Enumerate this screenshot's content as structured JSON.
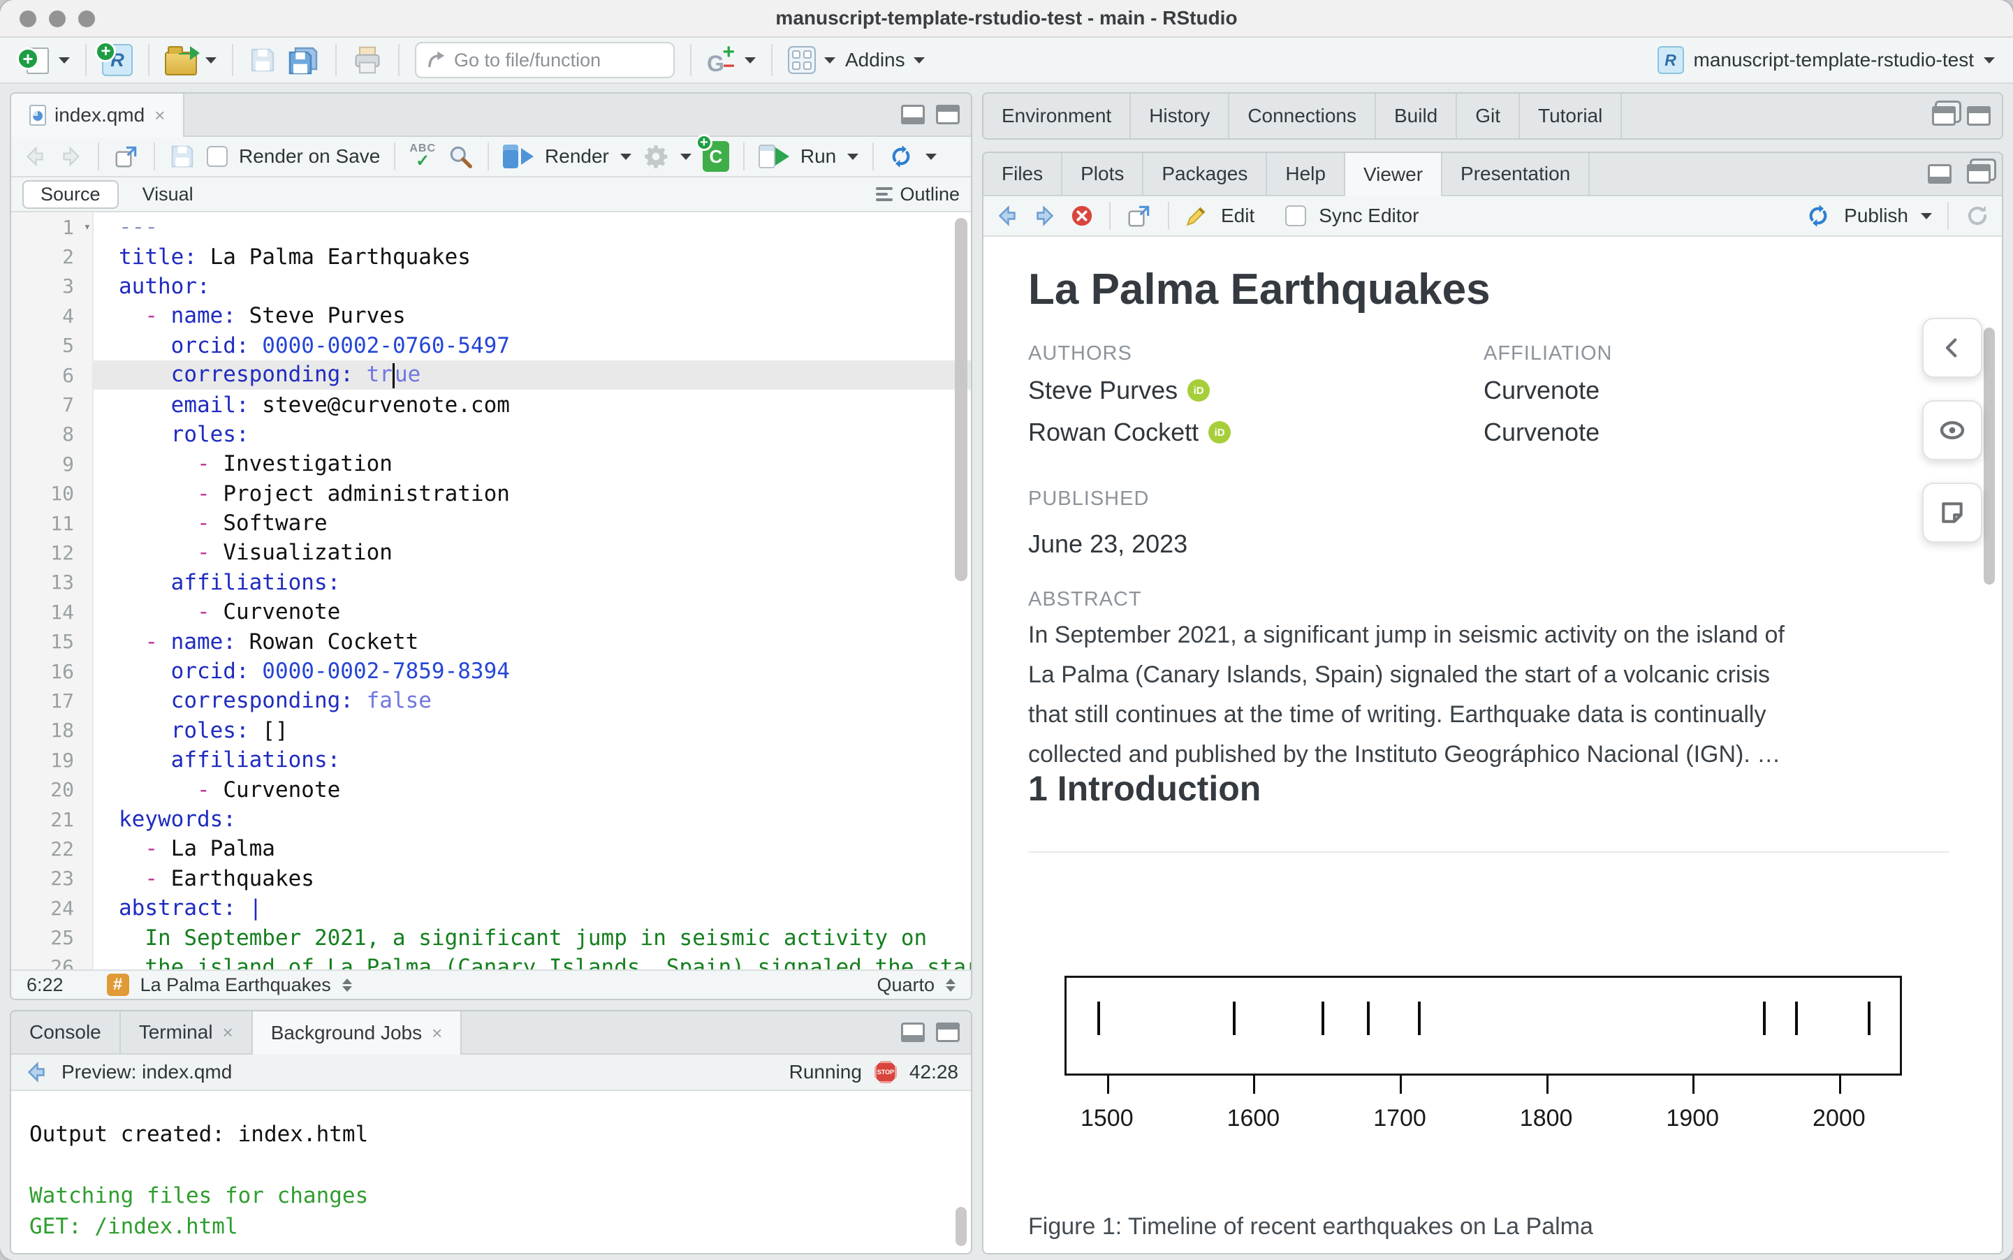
{
  "window": {
    "title": "manuscript-template-rstudio-test - main - RStudio"
  },
  "main_toolbar": {
    "goto_placeholder": "Go to file/function",
    "addins_label": "Addins",
    "project_name": "manuscript-template-rstudio-test"
  },
  "editor": {
    "tabs": [
      {
        "label": "index.qmd",
        "active": true,
        "closable": true
      }
    ],
    "toolbar": {
      "render_on_save": "Render on Save",
      "render": "Render",
      "run": "Run"
    },
    "mode_tabs": {
      "source": "Source",
      "visual": "Visual",
      "outline": "Outline"
    },
    "status": {
      "cursor": "6:22",
      "section": "La Palma Earthquakes",
      "mode": "Quarto"
    },
    "code_lines": [
      [
        [
          "---",
          "delim"
        ]
      ],
      [
        [
          "title:",
          "key"
        ],
        [
          " La Palma Earthquakes",
          "val"
        ]
      ],
      [
        [
          "author:",
          "key"
        ]
      ],
      [
        [
          "  ",
          "val"
        ],
        [
          "- ",
          "dash"
        ],
        [
          "name:",
          "key"
        ],
        [
          " Steve Purves",
          "val"
        ]
      ],
      [
        [
          "    ",
          "val"
        ],
        [
          "orcid:",
          "key"
        ],
        [
          " 0000-0002-0760-5497",
          "num"
        ]
      ],
      [
        [
          "    ",
          "val"
        ],
        [
          "corresponding:",
          "key"
        ],
        [
          " tr",
          "bool"
        ],
        [
          "",
          "caret"
        ],
        [
          "ue",
          "bool"
        ]
      ],
      [
        [
          "    ",
          "val"
        ],
        [
          "email:",
          "key"
        ],
        [
          " steve@curvenote.com",
          "val"
        ]
      ],
      [
        [
          "    ",
          "val"
        ],
        [
          "roles:",
          "key"
        ]
      ],
      [
        [
          "      ",
          "val"
        ],
        [
          "- ",
          "dash"
        ],
        [
          "Investigation",
          "val"
        ]
      ],
      [
        [
          "      ",
          "val"
        ],
        [
          "- ",
          "dash"
        ],
        [
          "Project administration",
          "val"
        ]
      ],
      [
        [
          "      ",
          "val"
        ],
        [
          "- ",
          "dash"
        ],
        [
          "Software",
          "val"
        ]
      ],
      [
        [
          "      ",
          "val"
        ],
        [
          "- ",
          "dash"
        ],
        [
          "Visualization",
          "val"
        ]
      ],
      [
        [
          "    ",
          "val"
        ],
        [
          "affiliations:",
          "key"
        ]
      ],
      [
        [
          "      ",
          "val"
        ],
        [
          "- ",
          "dash"
        ],
        [
          "Curvenote",
          "val"
        ]
      ],
      [
        [
          "  ",
          "val"
        ],
        [
          "- ",
          "dash"
        ],
        [
          "name:",
          "key"
        ],
        [
          " Rowan Cockett",
          "val"
        ]
      ],
      [
        [
          "    ",
          "val"
        ],
        [
          "orcid:",
          "key"
        ],
        [
          " 0000-0002-7859-8394",
          "num"
        ]
      ],
      [
        [
          "    ",
          "val"
        ],
        [
          "corresponding:",
          "key"
        ],
        [
          " false",
          "bool"
        ]
      ],
      [
        [
          "    ",
          "val"
        ],
        [
          "roles:",
          "key"
        ],
        [
          " []",
          "val"
        ]
      ],
      [
        [
          "    ",
          "val"
        ],
        [
          "affiliations:",
          "key"
        ]
      ],
      [
        [
          "      ",
          "val"
        ],
        [
          "- ",
          "dash"
        ],
        [
          "Curvenote",
          "val"
        ]
      ],
      [
        [
          "keywords:",
          "key"
        ]
      ],
      [
        [
          "  ",
          "val"
        ],
        [
          "- ",
          "dash"
        ],
        [
          "La Palma",
          "val"
        ]
      ],
      [
        [
          "  ",
          "val"
        ],
        [
          "- ",
          "dash"
        ],
        [
          "Earthquakes",
          "val"
        ]
      ],
      [
        [
          "abstract:",
          "key"
        ],
        [
          " |",
          "key"
        ]
      ],
      [
        [
          "  In September 2021, a significant jump in seismic activity on",
          "str"
        ]
      ],
      [
        [
          "  the island of La Palma (Canary Islands, Spain) signaled the start",
          "str"
        ]
      ]
    ]
  },
  "console": {
    "tabs": [
      {
        "label": "Console"
      },
      {
        "label": "Terminal",
        "closable": true
      },
      {
        "label": "Background Jobs",
        "closable": true,
        "active": true
      }
    ],
    "toolbar": {
      "preview": "Preview: index.qmd",
      "status": "Running",
      "timer": "42:28"
    },
    "output": [
      {
        "text": "Output created: index.html",
        "color": "default"
      },
      {
        "text": "",
        "color": "default"
      },
      {
        "text": "Watching files for changes",
        "color": "green"
      },
      {
        "text": "GET: /index.html",
        "color": "green"
      }
    ]
  },
  "right_top_tabs": [
    {
      "label": "Environment"
    },
    {
      "label": "History"
    },
    {
      "label": "Connections"
    },
    {
      "label": "Build"
    },
    {
      "label": "Git"
    },
    {
      "label": "Tutorial"
    }
  ],
  "right_bottom": {
    "tabs": [
      {
        "label": "Files"
      },
      {
        "label": "Plots"
      },
      {
        "label": "Packages"
      },
      {
        "label": "Help"
      },
      {
        "label": "Viewer",
        "active": true
      },
      {
        "label": "Presentation"
      }
    ],
    "toolbar": {
      "edit": "Edit",
      "sync": "Sync Editor",
      "publish": "Publish"
    }
  },
  "document": {
    "title": "La Palma Earthquakes",
    "authors_label": "AUTHORS",
    "affiliation_label": "AFFILIATION",
    "authors": [
      {
        "name": "Steve Purves",
        "orcid": true,
        "affiliation": "Curvenote"
      },
      {
        "name": "Rowan Cockett",
        "orcid": true,
        "affiliation": "Curvenote"
      }
    ],
    "published_label": "PUBLISHED",
    "published_date": "June 23, 2023",
    "abstract_label": "ABSTRACT",
    "abstract_lines": [
      "In September 2021, a significant jump in seismic activity on the island of",
      "La Palma (Canary Islands, Spain) signaled the start of a volcanic crisis",
      "that still continues at the time of writing. Earthquake data is continually",
      "collected and published by the Instituto Geográphico Nacional (IGN). …"
    ],
    "section_heading": "1 Introduction"
  },
  "chart_data": {
    "type": "rug",
    "title": "",
    "xlabel": "",
    "x": [
      1492,
      1585,
      1646,
      1677,
      1712,
      1949,
      1971,
      2021
    ],
    "xticks": [
      1500,
      1600,
      1700,
      1800,
      1900,
      2000
    ],
    "xlim": [
      1471,
      2043
    ],
    "caption": "Figure 1: Timeline of recent earthquakes on La Palma"
  },
  "colors": {
    "orcid_green": "#a6ce39",
    "run_green": "#2da44e",
    "accent_blue": "#4f93d8",
    "stop_red": "#d9453d",
    "console_green": "#2f9e2f",
    "yaml_key_blue": "#1f2bbf",
    "yaml_dash_magenta": "#c0399e",
    "yaml_string_green": "#15801f"
  }
}
